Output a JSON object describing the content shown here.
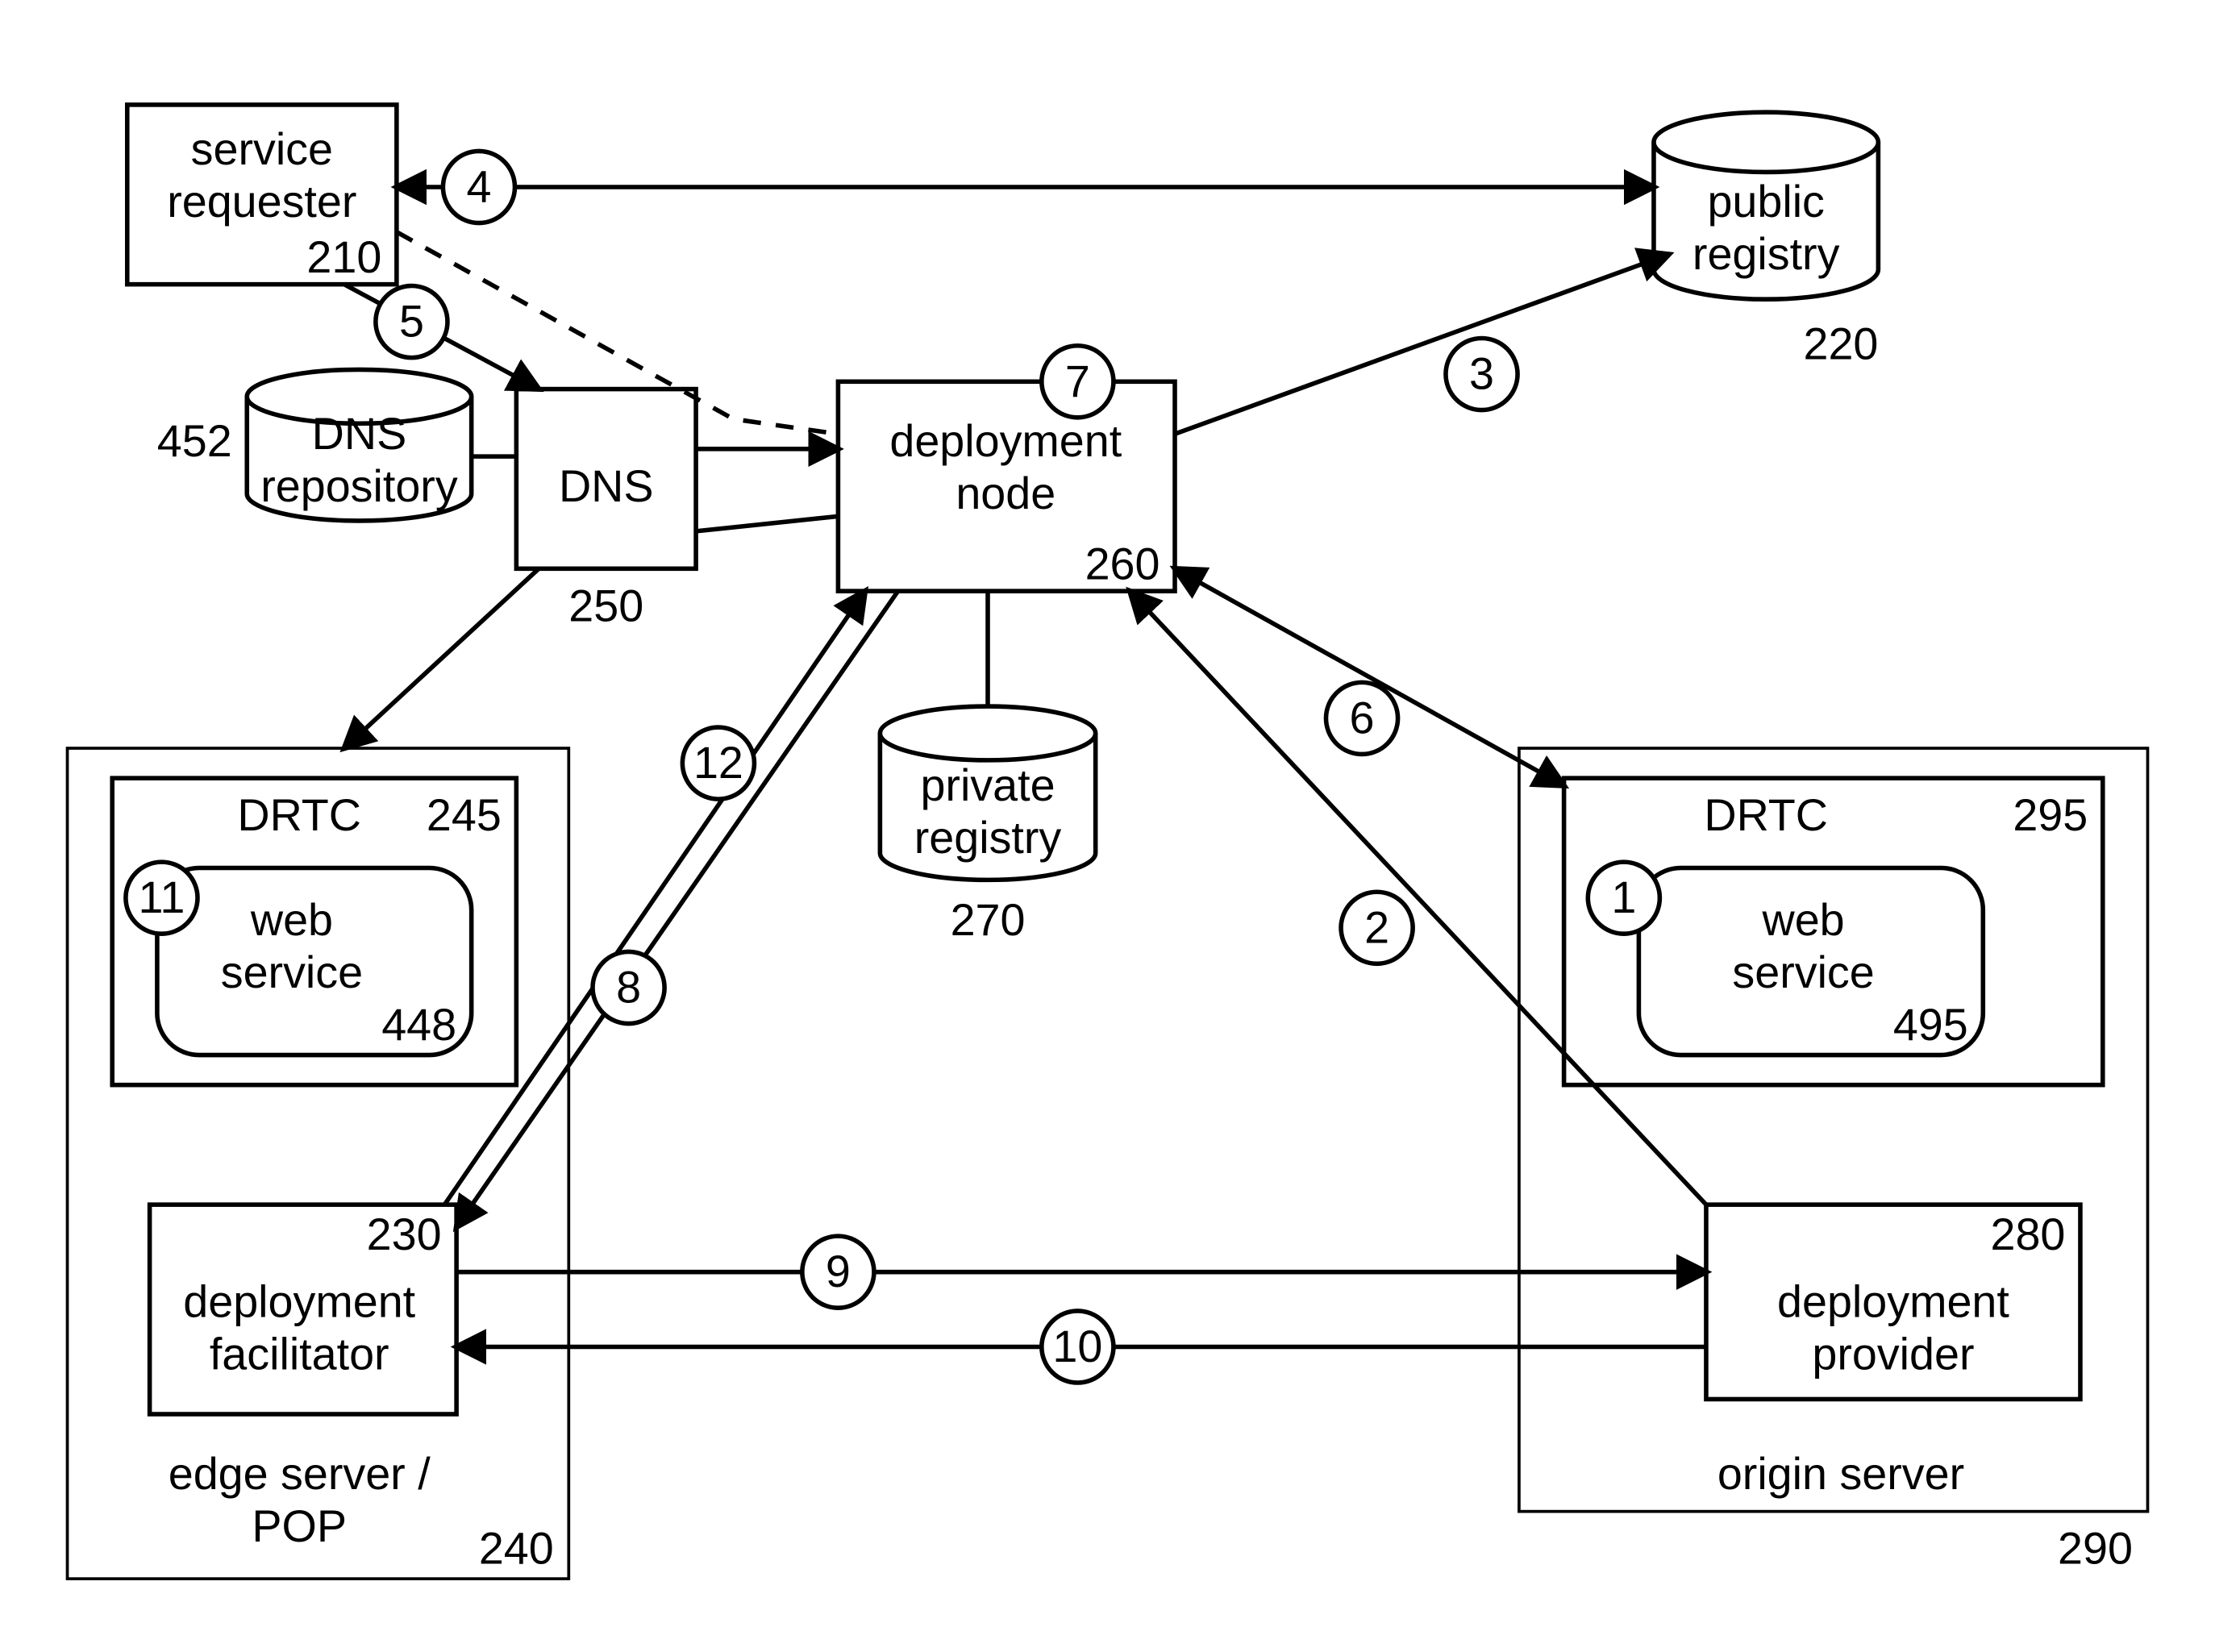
{
  "nodes": {
    "service_requester": {
      "label1": "service",
      "label2": "requester",
      "num": "210"
    },
    "public_registry": {
      "label1": "public",
      "label2": "registry",
      "num": "220"
    },
    "dns_repo": {
      "label1": "DNS",
      "label2": "repository",
      "num": "452"
    },
    "dns": {
      "label": "DNS",
      "num": "250"
    },
    "deployment_node": {
      "label1": "deployment",
      "label2": "node",
      "num": "260"
    },
    "private_registry": {
      "label1": "private",
      "label2": "registry",
      "num": "270"
    },
    "edge_server": {
      "label1": "edge server /",
      "label2": "POP",
      "num": "240"
    },
    "drtc_left": {
      "label": "DRTC",
      "num": "245"
    },
    "web_left": {
      "label1": "web",
      "label2": "service",
      "num": "448"
    },
    "deployment_facilitator": {
      "label1": "deployment",
      "label2": "facilitator",
      "num": "230"
    },
    "origin_server": {
      "label": "origin server",
      "num": "290"
    },
    "drtc_right": {
      "label": "DRTC",
      "num": "295"
    },
    "web_right": {
      "label1": "web",
      "label2": "service",
      "num": "495"
    },
    "deployment_provider": {
      "label1": "deployment",
      "label2": "provider",
      "num": "280"
    }
  },
  "steps": {
    "s1": "1",
    "s2": "2",
    "s3": "3",
    "s4": "4",
    "s5": "5",
    "s6": "6",
    "s7": "7",
    "s8": "8",
    "s9": "9",
    "s10": "10",
    "s11": "11",
    "s12": "12"
  }
}
